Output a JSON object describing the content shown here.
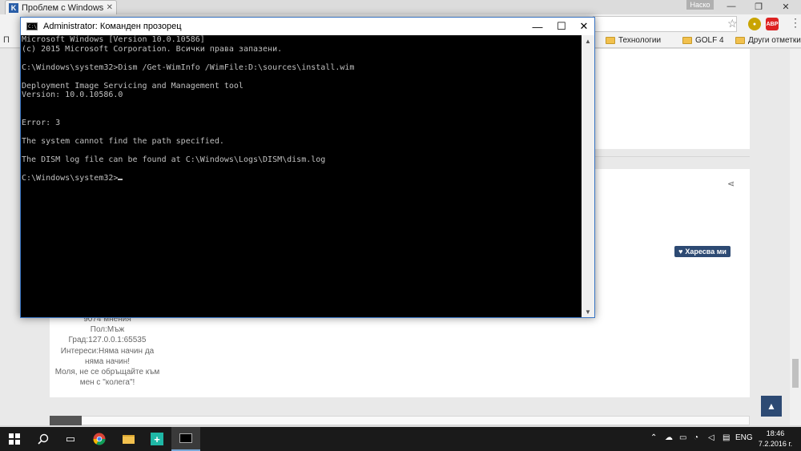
{
  "browser": {
    "tab_title": "Проблем с Windows Spot",
    "tab_favicon": "K",
    "user_badge": "Наско",
    "bookmarks_left": "П",
    "bookmarks": [
      "Технологии",
      "GOLF 4"
    ],
    "bookmarks_other": "Други отметки",
    "extension_label": "ABP"
  },
  "page": {
    "like_label": "Харесва ми",
    "profile_lines": [
      "9074 мнения",
      "Пол:Мъж",
      "Град:127.0.0.1:65535",
      "Интереси:Няма начин да",
      "няма начин!",
      "Моля, не се обръщайте към",
      "мен с \"колега\"!"
    ]
  },
  "cmd": {
    "title": "Administrator: Команден прозорец",
    "lines": [
      "Microsoft Windows [Version 10.0.10586]",
      "(c) 2015 Microsoft Corporation. Всички права запазени.",
      "",
      "C:\\Windows\\system32>Dism /Get-WimInfo /WimFile:D:\\sources\\install.wim",
      "",
      "Deployment Image Servicing and Management tool",
      "Version: 10.0.10586.0",
      "",
      "",
      "Error: 3",
      "",
      "The system cannot find the path specified.",
      "",
      "The DISM log file can be found at C:\\Windows\\Logs\\DISM\\dism.log",
      "",
      "C:\\Windows\\system32>"
    ]
  },
  "taskbar": {
    "language": "ENG",
    "time": "18:46",
    "date": "7.2.2016 г."
  },
  "colors": {
    "cmd_text": "#c0c0c0",
    "cmd_border": "#3b76c4",
    "forum_accent": "#2d4a73",
    "taskbar": "#1a1a1a"
  }
}
